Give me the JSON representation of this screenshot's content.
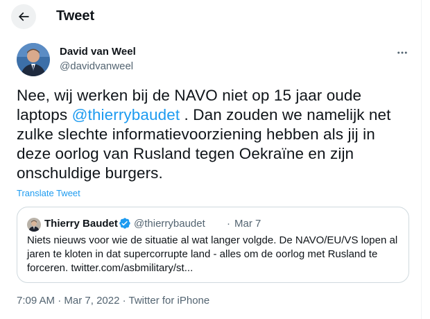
{
  "header": {
    "title": "Tweet"
  },
  "tweet": {
    "author_name": "David van Weel",
    "author_handle": "@davidvanweel",
    "text_lines": [
      {
        "before": "Nee, wij werken bij de NAVO niet op 15 jaar oude",
        "mention": "",
        "after": ""
      },
      {
        "before": "laptops ",
        "mention": "@thierrybaudet",
        "after": " . Dan zouden we namelijk net"
      },
      {
        "before": "zulke slechte informatievoorziening hebben als jij in",
        "mention": "",
        "after": ""
      },
      {
        "before": "deze oorlog van Rusland tegen Oekraïne en zijn",
        "mention": "",
        "after": ""
      },
      {
        "before": "onschuldige burgers.",
        "mention": "",
        "after": ""
      }
    ],
    "translate_label": "Translate Tweet",
    "time": "7:09 AM",
    "separator": "·",
    "date": "Mar 7, 2022",
    "source": "Twitter for iPhone"
  },
  "quote": {
    "name": "Thierry Baudet",
    "handle": "@thierrybaudet",
    "separator": "·",
    "date": "Mar 7",
    "text_lines": [
      "Niets nieuws voor wie de situatie al wat langer volgde. De NAVO/EU/VS lopen al",
      "jaren te kloten in dat supercorrupte land - alles om de oorlog met Rusland te",
      "forceren. twitter.com/asbmilitary/st..."
    ]
  },
  "colors": {
    "accent": "#1d9bf0",
    "text": "#0f1419",
    "secondary": "#536471",
    "border": "#cfd9de"
  },
  "icons": {
    "back": "arrow-left-icon",
    "more": "more-horizontal-icon",
    "verified": "verified-badge-icon"
  }
}
